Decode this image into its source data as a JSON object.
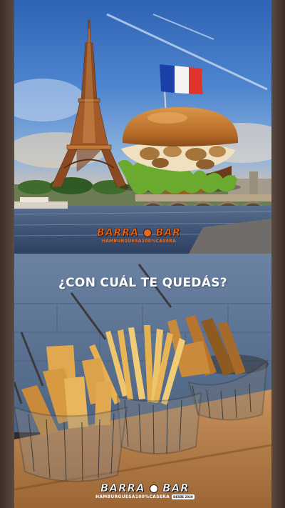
{
  "story": {
    "top_panel": {
      "logo": {
        "name": "BARRA",
        "name_end": "BAR",
        "tagline": "HAMBURGUESA100%CASERA",
        "badge": ""
      }
    },
    "bottom_panel": {
      "question": "¿CON CUÁL TE QUEDÁS?",
      "logo": {
        "name": "BARRA",
        "name_end": "BAR",
        "tagline": "HAMBURGUESA100%CASERA",
        "badge": "DESDE 2020"
      }
    }
  },
  "colors": {
    "brand_orange": "#e46a1e",
    "flag_blue": "#1d3fa8",
    "flag_red": "#e2332d"
  }
}
